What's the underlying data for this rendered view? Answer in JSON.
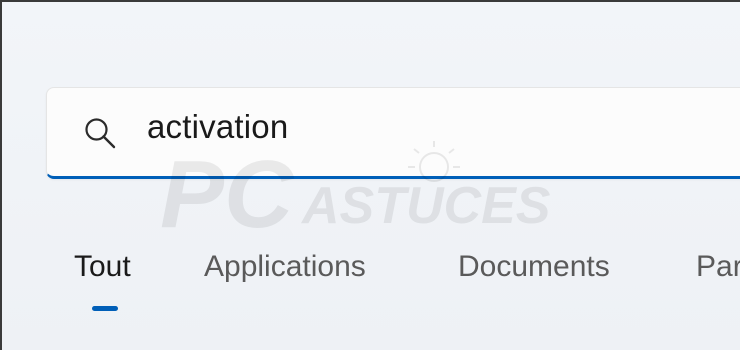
{
  "search": {
    "query": "activation"
  },
  "tabs": [
    {
      "label": "Tout",
      "active": true
    },
    {
      "label": "Applications",
      "active": false
    },
    {
      "label": "Documents",
      "active": false
    },
    {
      "label": "Par",
      "active": false
    }
  ],
  "watermark": {
    "text_main": "PC",
    "text_sub": "ASTUCES"
  },
  "colors": {
    "accent": "#005fb8",
    "background": "#f2f5f9",
    "text_primary": "#1a1a1a",
    "text_secondary": "#5a5a5a"
  },
  "icons": {
    "search": "search-icon"
  }
}
